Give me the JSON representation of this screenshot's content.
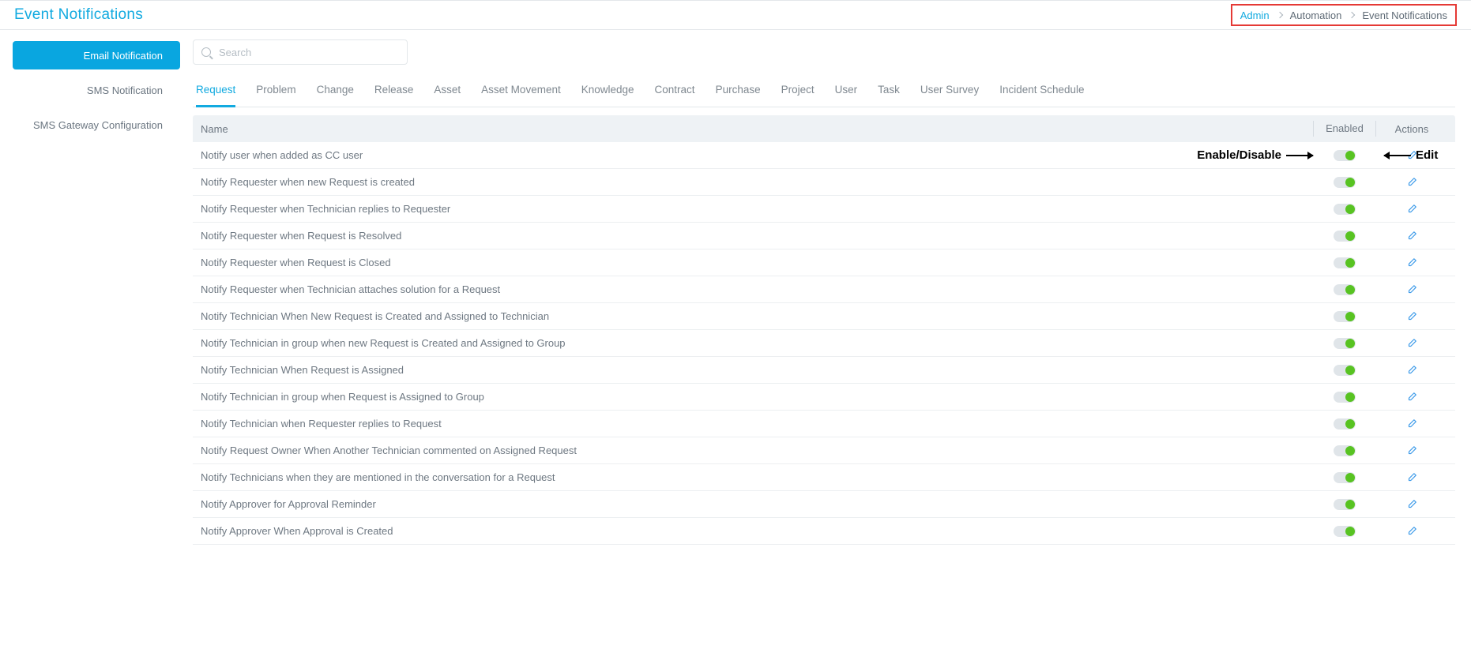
{
  "header": {
    "title": "Event Notifications",
    "breadcrumb": [
      "Admin",
      "Automation",
      "Event Notifications"
    ]
  },
  "sidebar": {
    "items": [
      {
        "label": "Email Notification",
        "active": true
      },
      {
        "label": "SMS Notification",
        "active": false
      },
      {
        "label": "SMS Gateway Configuration",
        "active": false
      }
    ]
  },
  "search": {
    "placeholder": "Search",
    "value": ""
  },
  "tabs": [
    {
      "label": "Request",
      "active": true
    },
    {
      "label": "Problem"
    },
    {
      "label": "Change"
    },
    {
      "label": "Release"
    },
    {
      "label": "Asset"
    },
    {
      "label": "Asset Movement"
    },
    {
      "label": "Knowledge"
    },
    {
      "label": "Contract"
    },
    {
      "label": "Purchase"
    },
    {
      "label": "Project"
    },
    {
      "label": "User"
    },
    {
      "label": "Task"
    },
    {
      "label": "User Survey"
    },
    {
      "label": "Incident Schedule"
    }
  ],
  "table": {
    "columns": {
      "name": "Name",
      "enabled": "Enabled",
      "actions": "Actions"
    },
    "rows": [
      {
        "name": "Notify user when added as CC user",
        "enabled": true
      },
      {
        "name": "Notify Requester when new Request is created",
        "enabled": true
      },
      {
        "name": "Notify Requester when Technician replies to Requester",
        "enabled": true
      },
      {
        "name": "Notify Requester when Request is Resolved",
        "enabled": true
      },
      {
        "name": "Notify Requester when Request is Closed",
        "enabled": true
      },
      {
        "name": "Notify Requester when Technician attaches solution for a Request",
        "enabled": true
      },
      {
        "name": "Notify Technician When New Request is Created and Assigned to Technician",
        "enabled": true
      },
      {
        "name": "Notify Technician in group when new Request is Created and Assigned to Group",
        "enabled": true
      },
      {
        "name": "Notify Technician When Request is Assigned",
        "enabled": true
      },
      {
        "name": "Notify Technician in group when Request is Assigned to Group",
        "enabled": true
      },
      {
        "name": "Notify Technician when Requester replies to Request",
        "enabled": true
      },
      {
        "name": "Notify Request Owner When Another Technician commented on Assigned Request",
        "enabled": true
      },
      {
        "name": "Notify Technicians when they are mentioned in the conversation for a Request",
        "enabled": true
      },
      {
        "name": "Notify Approver for Approval Reminder",
        "enabled": true
      },
      {
        "name": "Notify Approver When Approval is Created",
        "enabled": true
      }
    ]
  },
  "annotations": {
    "toggle": "Enable/Disable",
    "edit": "Edit"
  }
}
